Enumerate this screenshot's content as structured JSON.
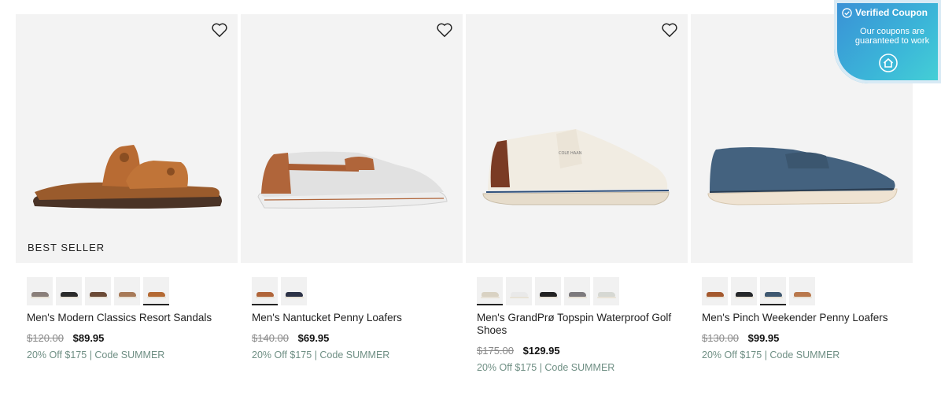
{
  "products": [
    {
      "badge": "BEST SELLER",
      "name": "Men's Modern Classics Resort Sandals",
      "was": "$120.00",
      "now": "$89.95",
      "promo": "20% Off $175 | Code SUMMER",
      "swatch_colors": [
        "#8a7f7a",
        "#2b2b2b",
        "#6b4a36",
        "#a77a58",
        "#b46a34"
      ],
      "selected_swatch": 4
    },
    {
      "badge": "",
      "name": "Men's Nantucket Penny Loafers",
      "was": "$140.00",
      "now": "$69.95",
      "promo": "20% Off $175 | Code SUMMER",
      "swatch_colors": [
        "#b0653a",
        "#2d3347"
      ],
      "selected_swatch": 0
    },
    {
      "badge": "",
      "name": "Men's GrandPrø Topspin Waterproof Golf Shoes",
      "was": "$175.00",
      "now": "$129.95",
      "promo": "20% Off $175 | Code SUMMER",
      "swatch_colors": [
        "#d9d2c3",
        "#e9e9e9",
        "#222222",
        "#7d7a7d",
        "#d6d8d3"
      ],
      "selected_swatch": 0
    },
    {
      "badge": "",
      "name": "Men's Pinch Weekender Penny Loafers",
      "was": "$130.00",
      "now": "$99.95",
      "promo": "20% Off $175 | Code SUMMER",
      "swatch_colors": [
        "#a4592e",
        "#26282b",
        "#3f5870",
        "#b9784c"
      ],
      "selected_swatch": 2
    }
  ],
  "coupon": {
    "title": "Verified Coupon",
    "subtitle": "Our coupons are guaranteed to work"
  },
  "icons": {
    "wishlist": "heart-icon",
    "verified": "check-circle-icon",
    "extension": "house-icon"
  }
}
